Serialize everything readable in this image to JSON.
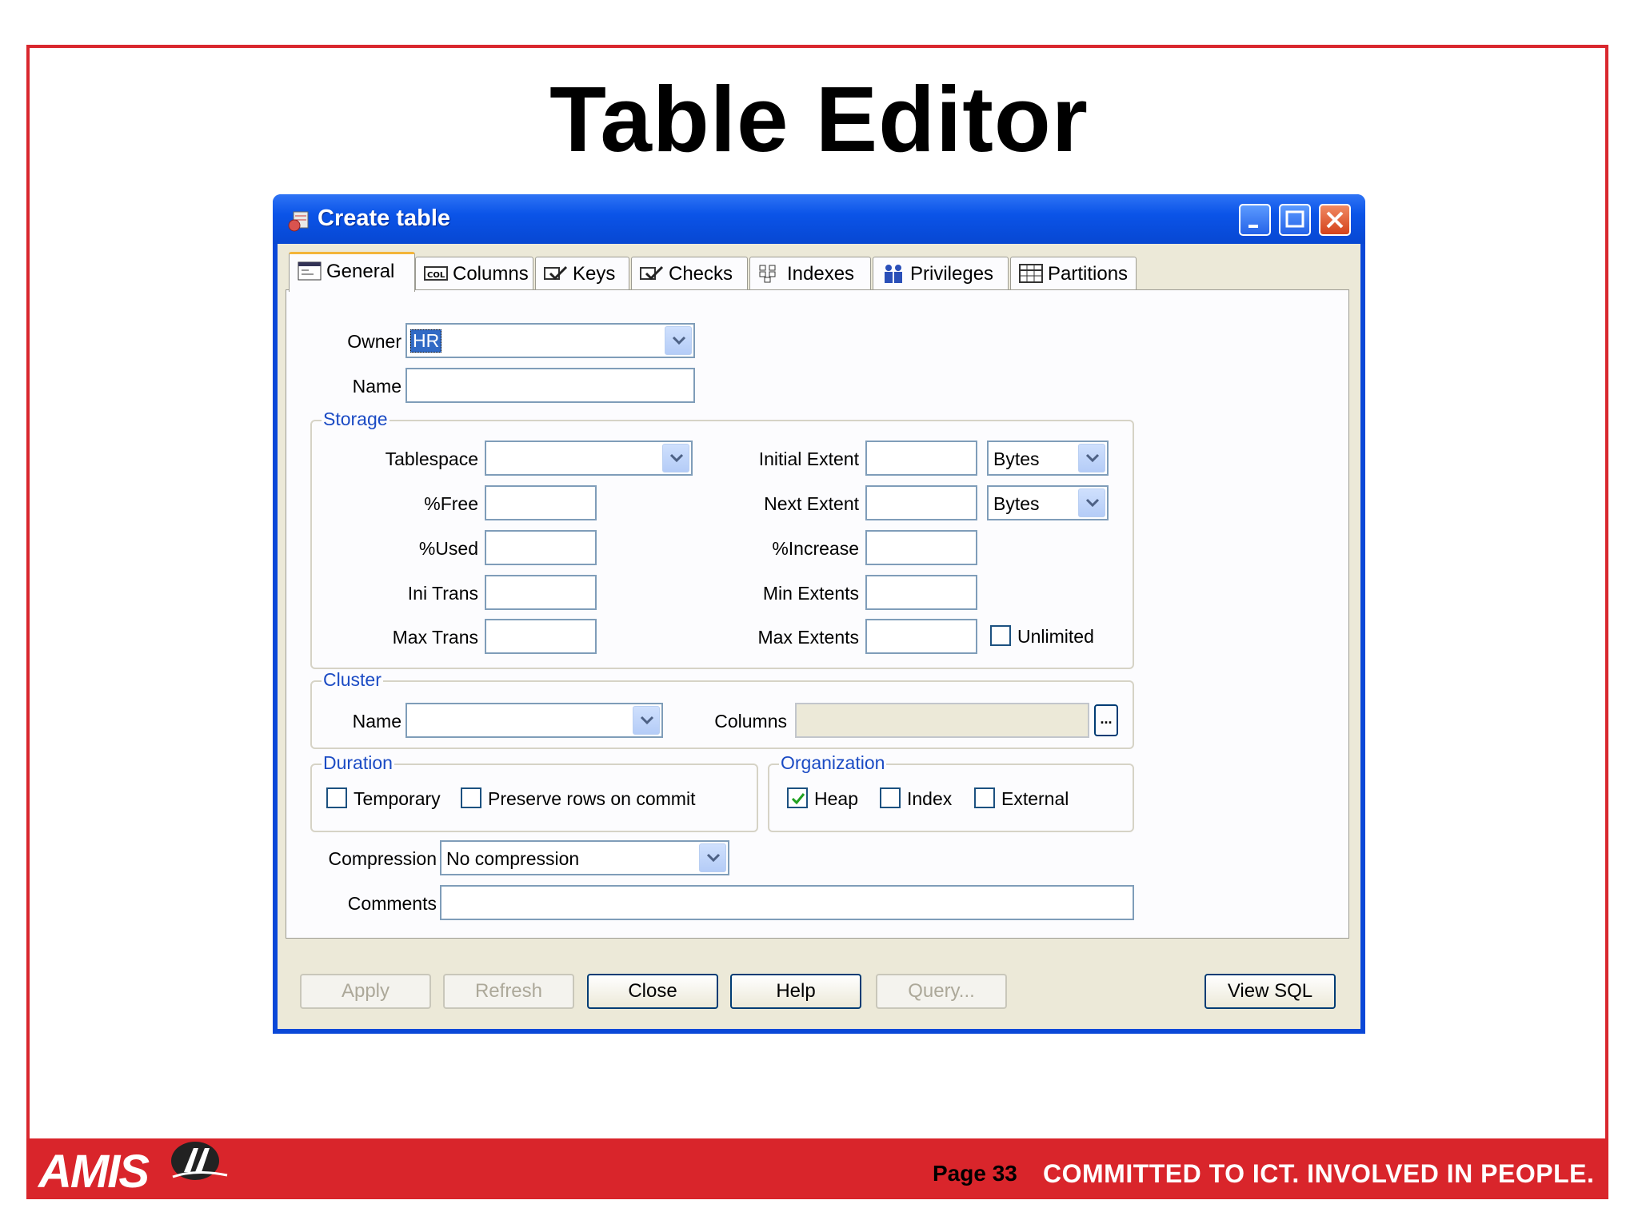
{
  "slide": {
    "title": "Table Editor",
    "page": "Page 33",
    "tagline": "COMMITTED TO ICT.  INVOLVED IN PEOPLE.",
    "brand_logo": "AMIS",
    "colors": {
      "frame": "#d9272e",
      "footer": "#d9252b"
    }
  },
  "window": {
    "title": "Create table",
    "controls": {
      "minimize": "minimize-icon",
      "maximize": "maximize-icon",
      "close": "close-icon"
    }
  },
  "tabs": [
    {
      "label": "General",
      "icon": "general-icon",
      "active": true
    },
    {
      "label": "Columns",
      "icon": "columns-icon"
    },
    {
      "label": "Keys",
      "icon": "keys-icon"
    },
    {
      "label": "Checks",
      "icon": "checks-icon"
    },
    {
      "label": "Indexes",
      "icon": "indexes-icon"
    },
    {
      "label": "Privileges",
      "icon": "privileges-icon"
    },
    {
      "label": "Partitions",
      "icon": "partitions-icon"
    }
  ],
  "general": {
    "owner_label": "Owner",
    "owner_value": "HR",
    "name_label": "Name",
    "name_value": ""
  },
  "storage": {
    "title": "Storage",
    "tablespace_label": "Tablespace",
    "tablespace_value": "",
    "free_label": "%Free",
    "used_label": "%Used",
    "ini_trans_label": "Ini Trans",
    "max_trans_label": "Max Trans",
    "initial_extent_label": "Initial Extent",
    "initial_extent_unit": "Bytes",
    "next_extent_label": "Next Extent",
    "next_extent_unit": "Bytes",
    "increase_label": "%Increase",
    "min_extents_label": "Min Extents",
    "max_extents_label": "Max Extents",
    "unlimited_label": "Unlimited"
  },
  "cluster": {
    "title": "Cluster",
    "name_label": "Name",
    "columns_label": "Columns",
    "ellipsis": "..."
  },
  "duration": {
    "title": "Duration",
    "temporary_label": "Temporary",
    "preserve_label": "Preserve rows on commit"
  },
  "organization": {
    "title": "Organization",
    "heap_label": "Heap",
    "heap_checked": true,
    "index_label": "Index",
    "external_label": "External"
  },
  "compression": {
    "label": "Compression",
    "value": "No compression"
  },
  "comments": {
    "label": "Comments",
    "value": ""
  },
  "buttons": {
    "apply": "Apply",
    "refresh": "Refresh",
    "close": "Close",
    "help": "Help",
    "query": "Query...",
    "view_sql": "View SQL"
  }
}
